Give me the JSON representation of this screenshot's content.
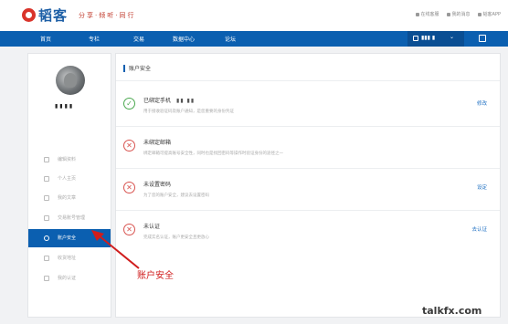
{
  "brand": {
    "logo_text": "韬客",
    "slogan": "分享·倾听·同行"
  },
  "top_links": [
    "在线客服",
    "我的消息",
    "韬客APP"
  ],
  "nav": {
    "items": [
      "首页",
      "专栏",
      "交易",
      "数据中心",
      "论坛"
    ],
    "user_name": "▮▮▮ ▮"
  },
  "sidebar": {
    "username": "▮▮▮▮",
    "menu": [
      {
        "label": "编辑资料",
        "active": false
      },
      {
        "label": "个人主页",
        "active": false
      },
      {
        "label": "我的文章",
        "active": false
      },
      {
        "label": "交易账号管理",
        "active": false
      },
      {
        "label": "账户安全",
        "active": true
      },
      {
        "label": "收货地址",
        "active": false
      },
      {
        "label": "我的认证",
        "active": false
      }
    ]
  },
  "main": {
    "title": "账户安全",
    "rows": [
      {
        "status": "ok",
        "title": "已绑定手机",
        "masked": "▮▮ ▮▮",
        "desc": "用于接收验证码及账户通知，是您重要的身份凭证",
        "action": "修改"
      },
      {
        "status": "warn",
        "title": "未绑定邮箱",
        "desc": "绑定邮箱可提高账号安全性，同时也是找回密码等操作时验证身份的途径之一",
        "action": ""
      },
      {
        "status": "warn",
        "title": "未设置密码",
        "desc": "为了您的账户安全，建议去设置密码",
        "action": "设定"
      },
      {
        "status": "warn",
        "title": "未认证",
        "desc": "完成实名认证，账户更安全且更放心",
        "action": "去认证"
      }
    ]
  },
  "annotation": {
    "label": "账户安全",
    "color": "#d01d1d"
  },
  "watermark": "talkfx.com",
  "colors": {
    "primary": "#0b5fb0",
    "warn": "#d8534f",
    "ok": "#4aa84f"
  }
}
